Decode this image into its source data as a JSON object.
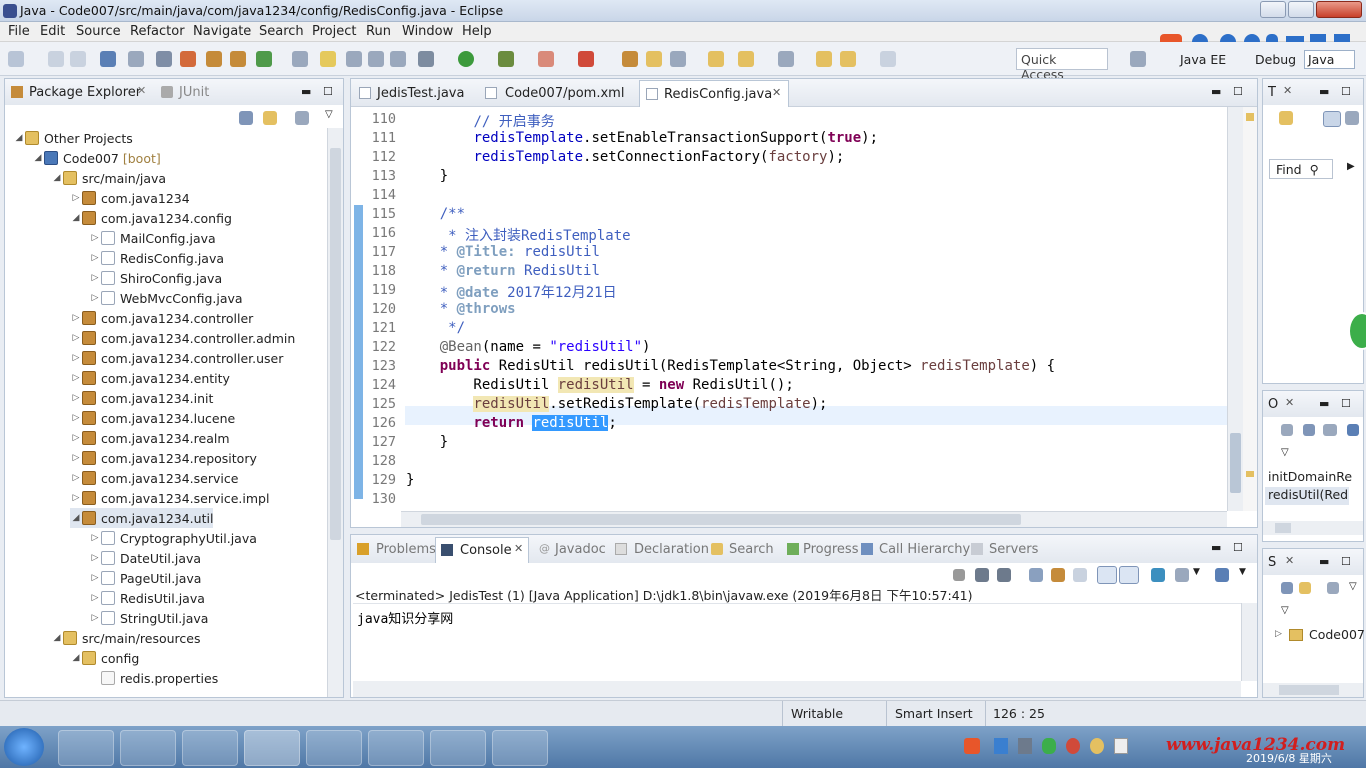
{
  "window": {
    "title": "Java - Code007/src/main/java/com/java1234/config/RedisConfig.java - Eclipse"
  },
  "menu": [
    "File",
    "Edit",
    "Source",
    "Refactor",
    "Navigate",
    "Search",
    "Project",
    "Run",
    "Window",
    "Help"
  ],
  "toolbar": {
    "quick_access": "Quick Access",
    "perspectives": [
      "Java EE",
      "Debug",
      "Java"
    ]
  },
  "package_explorer": {
    "tabs": [
      "Package Explorer",
      "JUnit"
    ],
    "tree": [
      {
        "label": "Other Projects",
        "type": "folder",
        "twisty": "open",
        "indent": 0
      },
      {
        "label": "Code007",
        "suffix": "[boot]",
        "type": "proj",
        "twisty": "open",
        "indent": 1
      },
      {
        "label": "src/main/java",
        "type": "folder",
        "twisty": "open",
        "indent": 2
      },
      {
        "label": "com.java1234",
        "type": "pkg",
        "twisty": "closed",
        "indent": 3
      },
      {
        "label": "com.java1234.config",
        "type": "pkg",
        "twisty": "open",
        "indent": 3
      },
      {
        "label": "MailConfig.java",
        "type": "java",
        "twisty": "closed",
        "indent": 4
      },
      {
        "label": "RedisConfig.java",
        "type": "java",
        "twisty": "closed",
        "indent": 4
      },
      {
        "label": "ShiroConfig.java",
        "type": "java",
        "twisty": "closed",
        "indent": 4
      },
      {
        "label": "WebMvcConfig.java",
        "type": "java",
        "twisty": "closed",
        "indent": 4
      },
      {
        "label": "com.java1234.controller",
        "type": "pkg",
        "twisty": "closed",
        "indent": 3
      },
      {
        "label": "com.java1234.controller.admin",
        "type": "pkg",
        "twisty": "closed",
        "indent": 3
      },
      {
        "label": "com.java1234.controller.user",
        "type": "pkg",
        "twisty": "closed",
        "indent": 3
      },
      {
        "label": "com.java1234.entity",
        "type": "pkg",
        "twisty": "closed",
        "indent": 3
      },
      {
        "label": "com.java1234.init",
        "type": "pkg",
        "twisty": "closed",
        "indent": 3
      },
      {
        "label": "com.java1234.lucene",
        "type": "pkg",
        "twisty": "closed",
        "indent": 3
      },
      {
        "label": "com.java1234.realm",
        "type": "pkg",
        "twisty": "closed",
        "indent": 3
      },
      {
        "label": "com.java1234.repository",
        "type": "pkg",
        "twisty": "closed",
        "indent": 3
      },
      {
        "label": "com.java1234.service",
        "type": "pkg",
        "twisty": "closed",
        "indent": 3
      },
      {
        "label": "com.java1234.service.impl",
        "type": "pkg",
        "twisty": "closed",
        "indent": 3
      },
      {
        "label": "com.java1234.util",
        "type": "pkg",
        "twisty": "open",
        "indent": 3
      },
      {
        "label": "CryptographyUtil.java",
        "type": "java",
        "twisty": "closed",
        "indent": 4
      },
      {
        "label": "DateUtil.java",
        "type": "java",
        "twisty": "closed",
        "indent": 4
      },
      {
        "label": "PageUtil.java",
        "type": "java",
        "twisty": "closed",
        "indent": 4
      },
      {
        "label": "RedisUtil.java",
        "type": "java",
        "twisty": "closed",
        "indent": 4
      },
      {
        "label": "StringUtil.java",
        "type": "java",
        "twisty": "closed",
        "indent": 4
      },
      {
        "label": "src/main/resources",
        "type": "folder",
        "twisty": "open",
        "indent": 2
      },
      {
        "label": "config",
        "type": "folder",
        "twisty": "open",
        "indent": 3
      },
      {
        "label": "redis.properties",
        "type": "file",
        "twisty": "",
        "indent": 4
      }
    ]
  },
  "editor": {
    "tabs": [
      "JedisTest.java",
      "Code007/pom.xml",
      "RedisConfig.java"
    ],
    "line_numbers": [
      "110",
      "111",
      "112",
      "113",
      "114",
      "115",
      "116",
      "117",
      "118",
      "119",
      "120",
      "121",
      "122",
      "123",
      "124",
      "125",
      "126",
      "127",
      "128",
      "129",
      "130"
    ]
  },
  "outline": {
    "find": "Find",
    "items": [
      "initDomainRe",
      "redisUtil(Red"
    ],
    "tree_item": "Code007"
  },
  "console": {
    "tabs": [
      "Problems",
      "Console",
      "Javadoc",
      "Declaration",
      "Search",
      "Progress",
      "Call Hierarchy",
      "Servers"
    ],
    "status": "<terminated> JedisTest (1) [Java Application] D:\\jdk1.8\\bin\\javaw.exe (2019年6月8日 下午10:57:41)",
    "output": "java知识分享网"
  },
  "statusbar": {
    "mode": "Writable",
    "insert": "Smart Insert",
    "position": "126 : 25"
  },
  "taskbar": {
    "date": "2019/6/8 星期六",
    "watermark": "www.java1234.com"
  },
  "colors": {
    "selection": "#3399ff",
    "keyword": "#7f0055",
    "comment": "#3f5fbf"
  }
}
